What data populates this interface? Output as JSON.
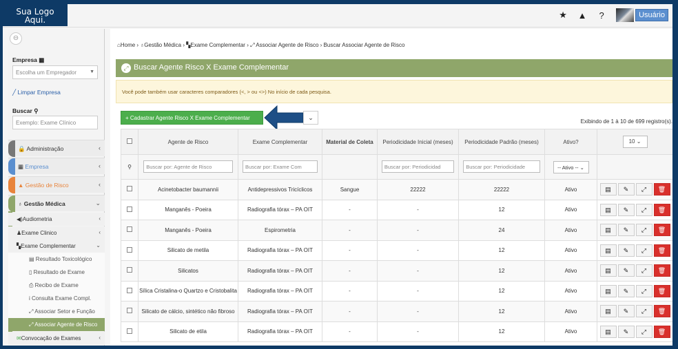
{
  "logo": {
    "line1": "Sua Logo",
    "line2": "Aqui."
  },
  "topbar": {
    "star": "★",
    "alert": "▲",
    "help": "?",
    "user_label": "Usuário"
  },
  "sidebar": {
    "empresa_label": "Empresa",
    "empresa_placeholder": "Escolha um Empregador",
    "limpar": "Limpar Empresa",
    "buscar_label": "Buscar",
    "buscar_placeholder": "Exemplo: Exame Clínico",
    "menu": [
      {
        "label": "Administração",
        "color": "#777777"
      },
      {
        "label": "Empresa",
        "color": "#5b8fcf"
      },
      {
        "label": "Gestão de Risco",
        "color": "#e8843c"
      },
      {
        "label": "Gestão Médica",
        "color": "#8fa66a"
      }
    ],
    "submenu": [
      {
        "label": "Audiometria"
      },
      {
        "label": "Exame Clinico"
      },
      {
        "label": "Exame Complementar"
      }
    ],
    "subsub": [
      {
        "label": "Resultado Toxicológico"
      },
      {
        "label": "Resultado de Exame"
      },
      {
        "label": "Recibo de Exame"
      },
      {
        "label": "Consulta Exame Compl."
      },
      {
        "label": "Associar Setor e Função"
      },
      {
        "label": "Associar Agente de Risco"
      }
    ],
    "convocacao": "Convocação de Exames"
  },
  "breadcrumb": {
    "home": "Home",
    "items": [
      "Gestão Médica",
      "Exame Complementar",
      "Associar Agente de Risco",
      "Buscar Associar Agente de Risco"
    ]
  },
  "panel": {
    "title": "Buscar Agente Risco X Exame Complementar",
    "alert": "Você pode também usar caracteres comparadores (<, > ou <>) No início de cada pesquisa.",
    "new_button": "+ Cadastrar Agente Risco X Exame Complementar",
    "count": "Exibindo de 1 à 10 de 699 registro(s)."
  },
  "table": {
    "headers": {
      "agente": "Agente de Risco",
      "exame": "Exame Complementar",
      "material": "Material de Coleta",
      "per_inicial": "Periodicidade Inicial (meses)",
      "per_padrao": "Periodicidade Padrão (meses)",
      "ativo": "Ativo?",
      "page_size": "10"
    },
    "filters": {
      "agente": "Buscar por: Agente de Risco",
      "exame": "Buscar por: Exame Com",
      "per_inicial": "Buscar por: Periodicidad",
      "per_padrao": "Buscar por: Periodicidade",
      "ativo": "-- Ativo --"
    },
    "rows": [
      {
        "agente": "Acinetobacter baumannii",
        "exame": "Antidepressivos Tricíclicos",
        "material": "Sangue",
        "inicial": "22222",
        "padrao": "22222",
        "ativo": "Ativo"
      },
      {
        "agente": "Manganês - Poeira",
        "exame": "Radiografia tórax – PA OIT",
        "material": "-",
        "inicial": "-",
        "padrao": "12",
        "ativo": "Ativo"
      },
      {
        "agente": "Manganês - Poeira",
        "exame": "Espirometria",
        "material": "-",
        "inicial": "-",
        "padrao": "24",
        "ativo": "Ativo"
      },
      {
        "agente": "Silicato de metila",
        "exame": "Radiografia tórax – PA OIT",
        "material": "-",
        "inicial": "-",
        "padrao": "12",
        "ativo": "Ativo"
      },
      {
        "agente": "Silicatos",
        "exame": "Radiografia tórax – PA OIT",
        "material": "-",
        "inicial": "-",
        "padrao": "12",
        "ativo": "Ativo"
      },
      {
        "agente": "Sílica Cristalina-o Quartzo e Cristobalita",
        "exame": "Radiografia tórax – PA OIT",
        "material": "-",
        "inicial": "-",
        "padrao": "12",
        "ativo": "Ativo"
      },
      {
        "agente": "Silicato de cálcio, sintético não fibroso",
        "exame": "Radiografia tórax – PA OIT",
        "material": "-",
        "inicial": "-",
        "padrao": "12",
        "ativo": "Ativo"
      },
      {
        "agente": "Silicato de etila",
        "exame": "Radiografia tórax – PA OIT",
        "material": "-",
        "inicial": "-",
        "padrao": "12",
        "ativo": "Ativo"
      }
    ]
  }
}
